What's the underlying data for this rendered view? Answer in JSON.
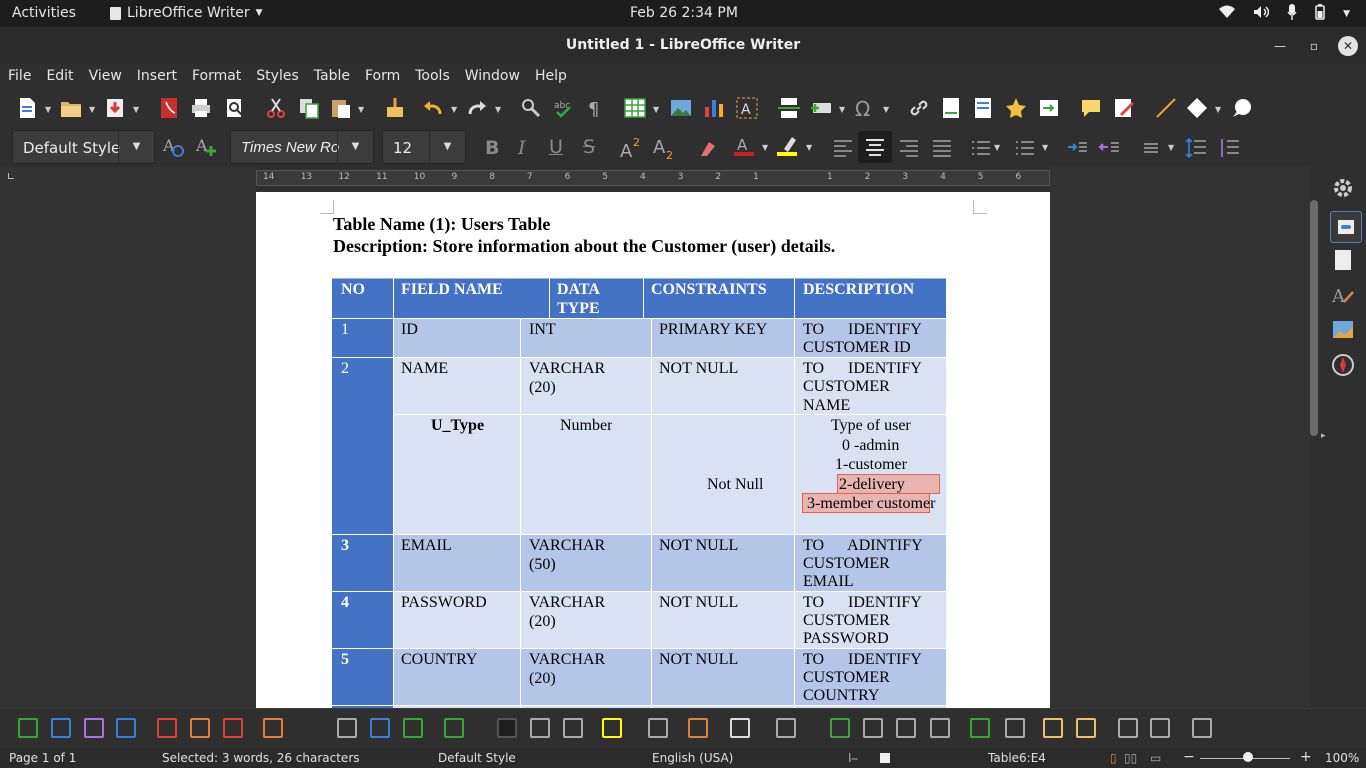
{
  "system_bar": {
    "activities": "Activities",
    "app_name": "LibreOffice Writer",
    "clock": "Feb 26  2:34 PM"
  },
  "window": {
    "title": "Untitled 1 - LibreOffice Writer"
  },
  "menu": [
    "File",
    "Edit",
    "View",
    "Insert",
    "Format",
    "Styles",
    "Table",
    "Form",
    "Tools",
    "Window",
    "Help"
  ],
  "formatting": {
    "paragraph_style": "Default Style",
    "font_name": "Times New Ro",
    "font_size": "12"
  },
  "ruler_ticks": [
    "14",
    "13",
    "12",
    "11",
    "10",
    "9",
    "8",
    "7",
    "6",
    "5",
    "4",
    "3",
    "2",
    "1",
    "1",
    "2",
    "3",
    "4",
    "5",
    "6"
  ],
  "document": {
    "heading1": "Table Name (1): Users Table",
    "heading2": "Description: Store information about the Customer (user) details.",
    "table": {
      "headers": {
        "no": "NO",
        "field": "FIELD NAME",
        "type_line1": "DATA",
        "type_line2": "TYPE",
        "constraints": "CONSTRAINTS",
        "description": "DESCRIPTION"
      },
      "rows": [
        {
          "no": "1",
          "field": "ID",
          "type": "INT",
          "constraint": "PRIMARY KEY",
          "desc1": "TO      IDENTIFY",
          "desc2": "CUSTOMER ID",
          "desc3": ""
        },
        {
          "no": "2",
          "field": "NAME",
          "type": "VARCHAR",
          "type2": "(20)",
          "constraint": "NOT NULL",
          "desc1": "TO      IDENTIFY",
          "desc2": "CUSTOMER",
          "desc3": "NAME"
        },
        {
          "no": "",
          "field": "U_Type",
          "type": "Number",
          "constraint": "Not Null",
          "desc_lines": [
            "Type of user",
            "0 -admin",
            "1-customer",
            "2-delivery",
            "3-member customer"
          ]
        },
        {
          "no": "3",
          "field": "EMAIL",
          "type": "VARCHAR",
          "type2": "(50)",
          "constraint": "NOT NULL",
          "desc1": "TO      ADINTIFY",
          "desc2": "CUSTOMER",
          "desc3": "EMAIL"
        },
        {
          "no": "4",
          "field": "PASSWORD",
          "type": "VARCHAR",
          "type2": "(20)",
          "constraint": "NOT NULL",
          "desc1": "TO      IDENTIFY",
          "desc2": "CUSTOMER",
          "desc3": "PASSWORD"
        },
        {
          "no": "5",
          "field": "COUNTRY",
          "type": "VARCHAR",
          "type2": "(20)",
          "constraint": "NOT NULL",
          "desc1": "TO      IDENTIFY",
          "desc2": "CUSTOMER",
          "desc3": "COUNTRY"
        }
      ]
    }
  },
  "status": {
    "page": "Page 1 of 1",
    "selection": "Selected: 3 words, 26 characters",
    "page_style": "Default Style",
    "language": "English (USA)",
    "cell": "Table6:E4",
    "zoom": "100%"
  },
  "colors": {
    "header_blue": "#4472c4",
    "row_dark": "#b4c6e7",
    "row_light": "#d9e2f3",
    "selection": "#e8b4b0"
  }
}
